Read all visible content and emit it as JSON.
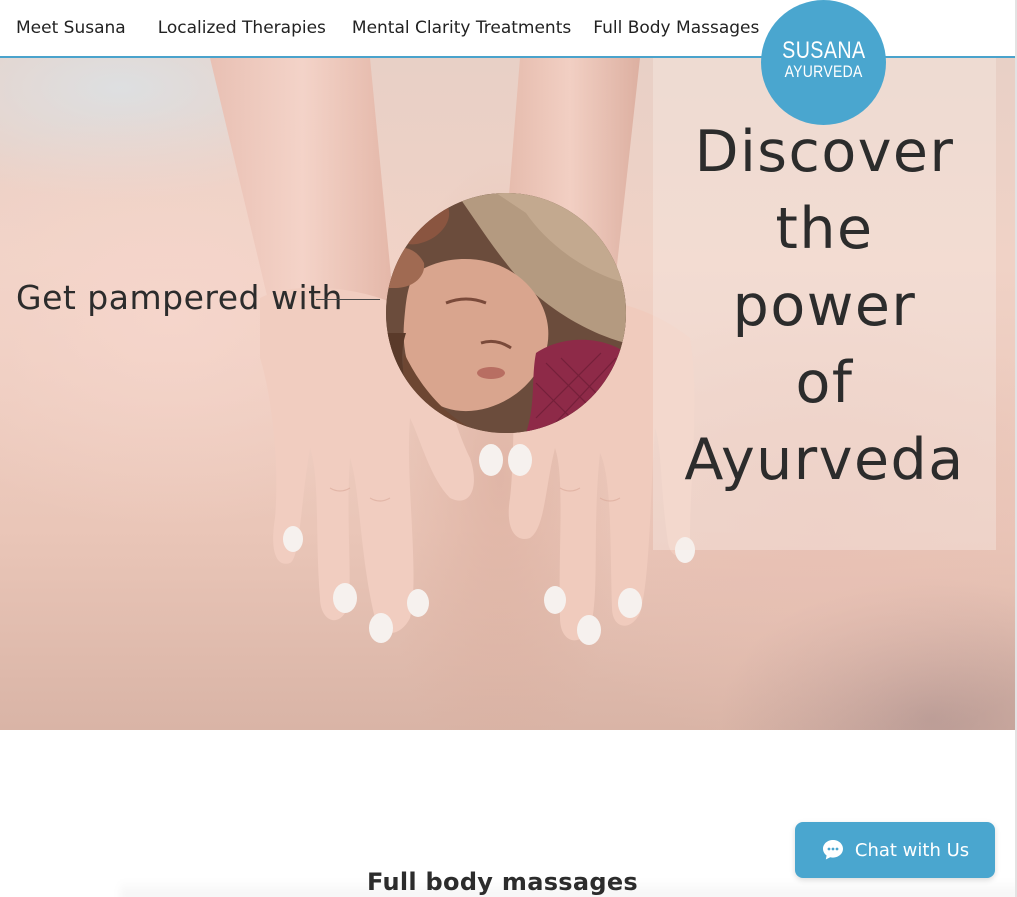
{
  "nav": {
    "items": [
      {
        "label": "Meet Susana"
      },
      {
        "label": "Localized Therapies"
      },
      {
        "label": "Mental Clarity Treatments"
      },
      {
        "label": "Full Body Massages"
      }
    ]
  },
  "logo": {
    "line1": "SUSANA",
    "line2": "AYURVEDA"
  },
  "hero": {
    "heading_lines": [
      "Discover",
      "the",
      "power",
      "of",
      "Ayurveda"
    ],
    "tagline": "Get pampered with"
  },
  "section": {
    "title": "Full body massages"
  },
  "chat": {
    "label": "Chat with Us",
    "icon": "chat-bubble-icon"
  },
  "colors": {
    "accent": "#4aa6cf",
    "text": "#2c2c2c"
  }
}
